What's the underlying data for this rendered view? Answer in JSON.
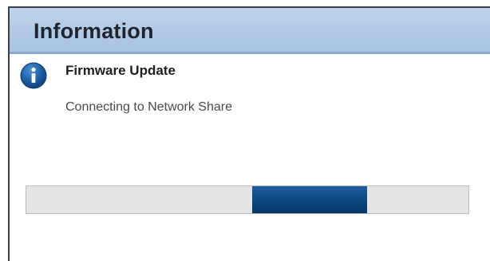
{
  "dialog": {
    "title": "Information",
    "icon": "info-icon",
    "heading": "Firmware Update",
    "message": "Connecting to Network Share",
    "progress": {
      "state": "indeterminate",
      "fill_color": "#0c4580",
      "track_color": "#e4e4e4"
    },
    "colors": {
      "titlebar": "#a8c2e0",
      "icon": "#1a5aa0"
    }
  }
}
